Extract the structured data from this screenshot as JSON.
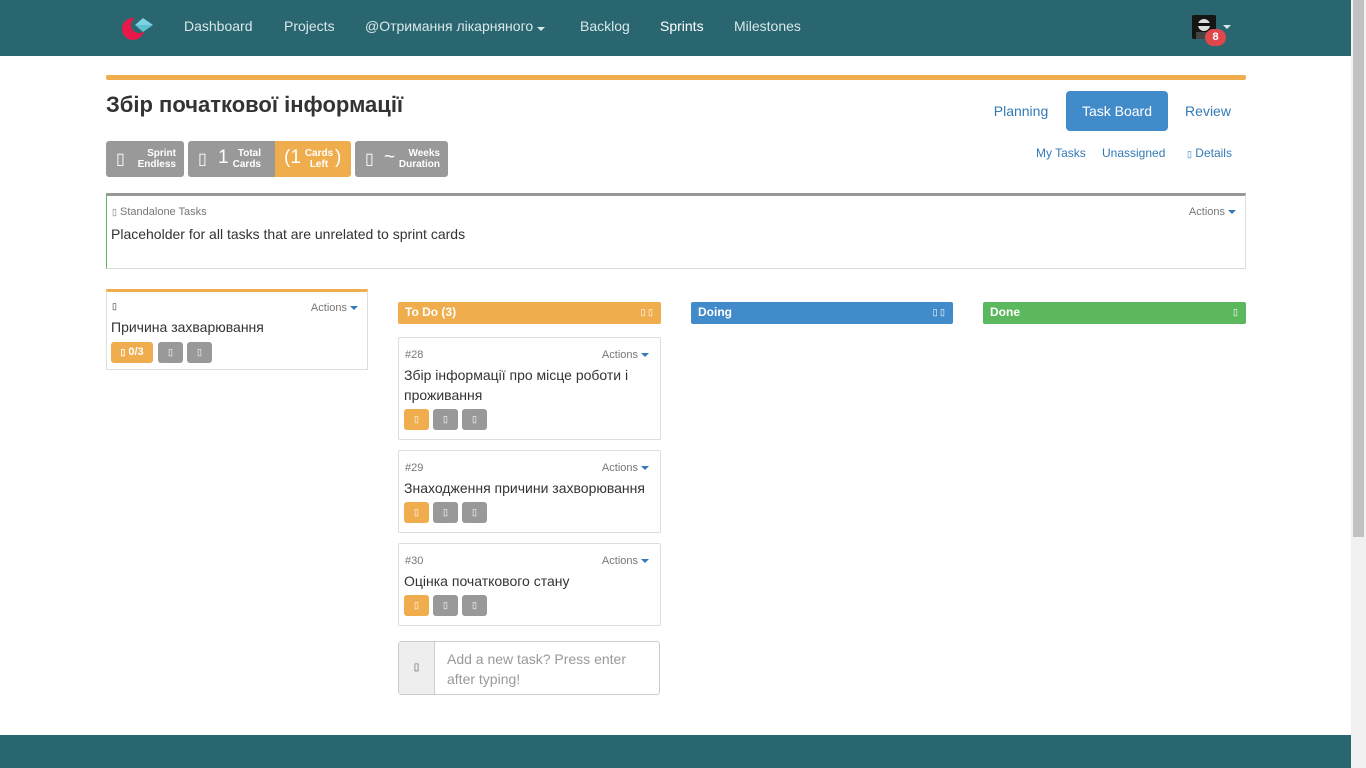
{
  "nav": {
    "items": [
      "Dashboard",
      "Projects",
      "@Отримання лікарняного",
      "Backlog",
      "Sprints",
      "Milestones"
    ],
    "notification_count": "8"
  },
  "page": {
    "title": "Збір початкової інформації"
  },
  "view_tabs": [
    "Planning",
    "Task Board",
    "Review"
  ],
  "stats": {
    "sprint_top": "Sprint",
    "sprint_bottom": "Endless",
    "total_value": "1",
    "total_top": "Total",
    "total_bottom": "Cards",
    "left_open": "(1",
    "left_top": "Cards",
    "left_bottom": "Left",
    "left_close": ")",
    "weeks_value": "~",
    "weeks_top": "Weeks",
    "weeks_bottom": "Duration"
  },
  "filters": {
    "my_tasks": "My Tasks",
    "unassigned": "Unassigned",
    "details": "Details"
  },
  "standalone": {
    "title": "Standalone Tasks",
    "actions": "Actions",
    "description": "Placeholder for all tasks that are unrelated to sprint cards"
  },
  "story": {
    "actions": "Actions",
    "title": "Причина захварювання",
    "progress": "0/3"
  },
  "columns": {
    "todo": "To Do (3)",
    "doing": "Doing",
    "done": "Done"
  },
  "tasks": [
    {
      "num": "#28",
      "actions": "Actions",
      "title": "Збір інформації про місце роботи і проживання"
    },
    {
      "num": "#29",
      "actions": "Actions",
      "title": "Знаходження причини захворювання"
    },
    {
      "num": "#30",
      "actions": "Actions",
      "title": "Оцінка початкового стану"
    }
  ],
  "add_task": {
    "placeholder": "Add a new task? Press enter after typing!"
  },
  "colors": {
    "navbar": "#2a6670",
    "accent": "#f0ad4e",
    "primary": "#428bca",
    "done": "#5cb85c",
    "muted": "#999999"
  }
}
